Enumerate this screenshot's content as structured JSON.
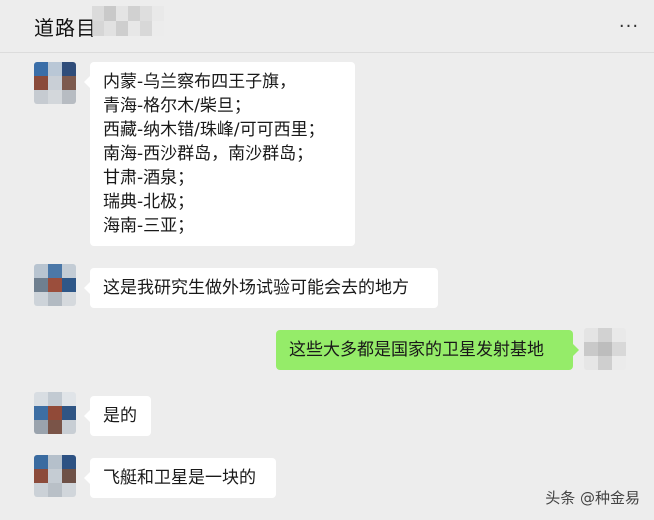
{
  "header": {
    "title": "道路目",
    "more_label": "···"
  },
  "messages": [
    {
      "sender": "other",
      "lines": [
        "内蒙-乌兰察布四王子旗，",
        "青海-格尔木/柴旦；",
        "西藏-纳木错/珠峰/可可西里；",
        "南海-西沙群岛，南沙群岛；",
        "甘肃-酒泉；",
        "瑞典-北极；",
        "海南-三亚；"
      ]
    },
    {
      "sender": "other",
      "lines": [
        "这是我研究生做外场试验可能会去的地方"
      ]
    },
    {
      "sender": "me",
      "lines": [
        "这些大多都是国家的卫星发射基地"
      ]
    },
    {
      "sender": "other",
      "lines": [
        "是的"
      ]
    },
    {
      "sender": "other",
      "lines": [
        "飞艇和卫星是一块的"
      ]
    }
  ],
  "watermark": "头条 @种金易",
  "colors": {
    "background": "#ededed",
    "bubble_other": "#ffffff",
    "bubble_me": "#95ec69"
  }
}
